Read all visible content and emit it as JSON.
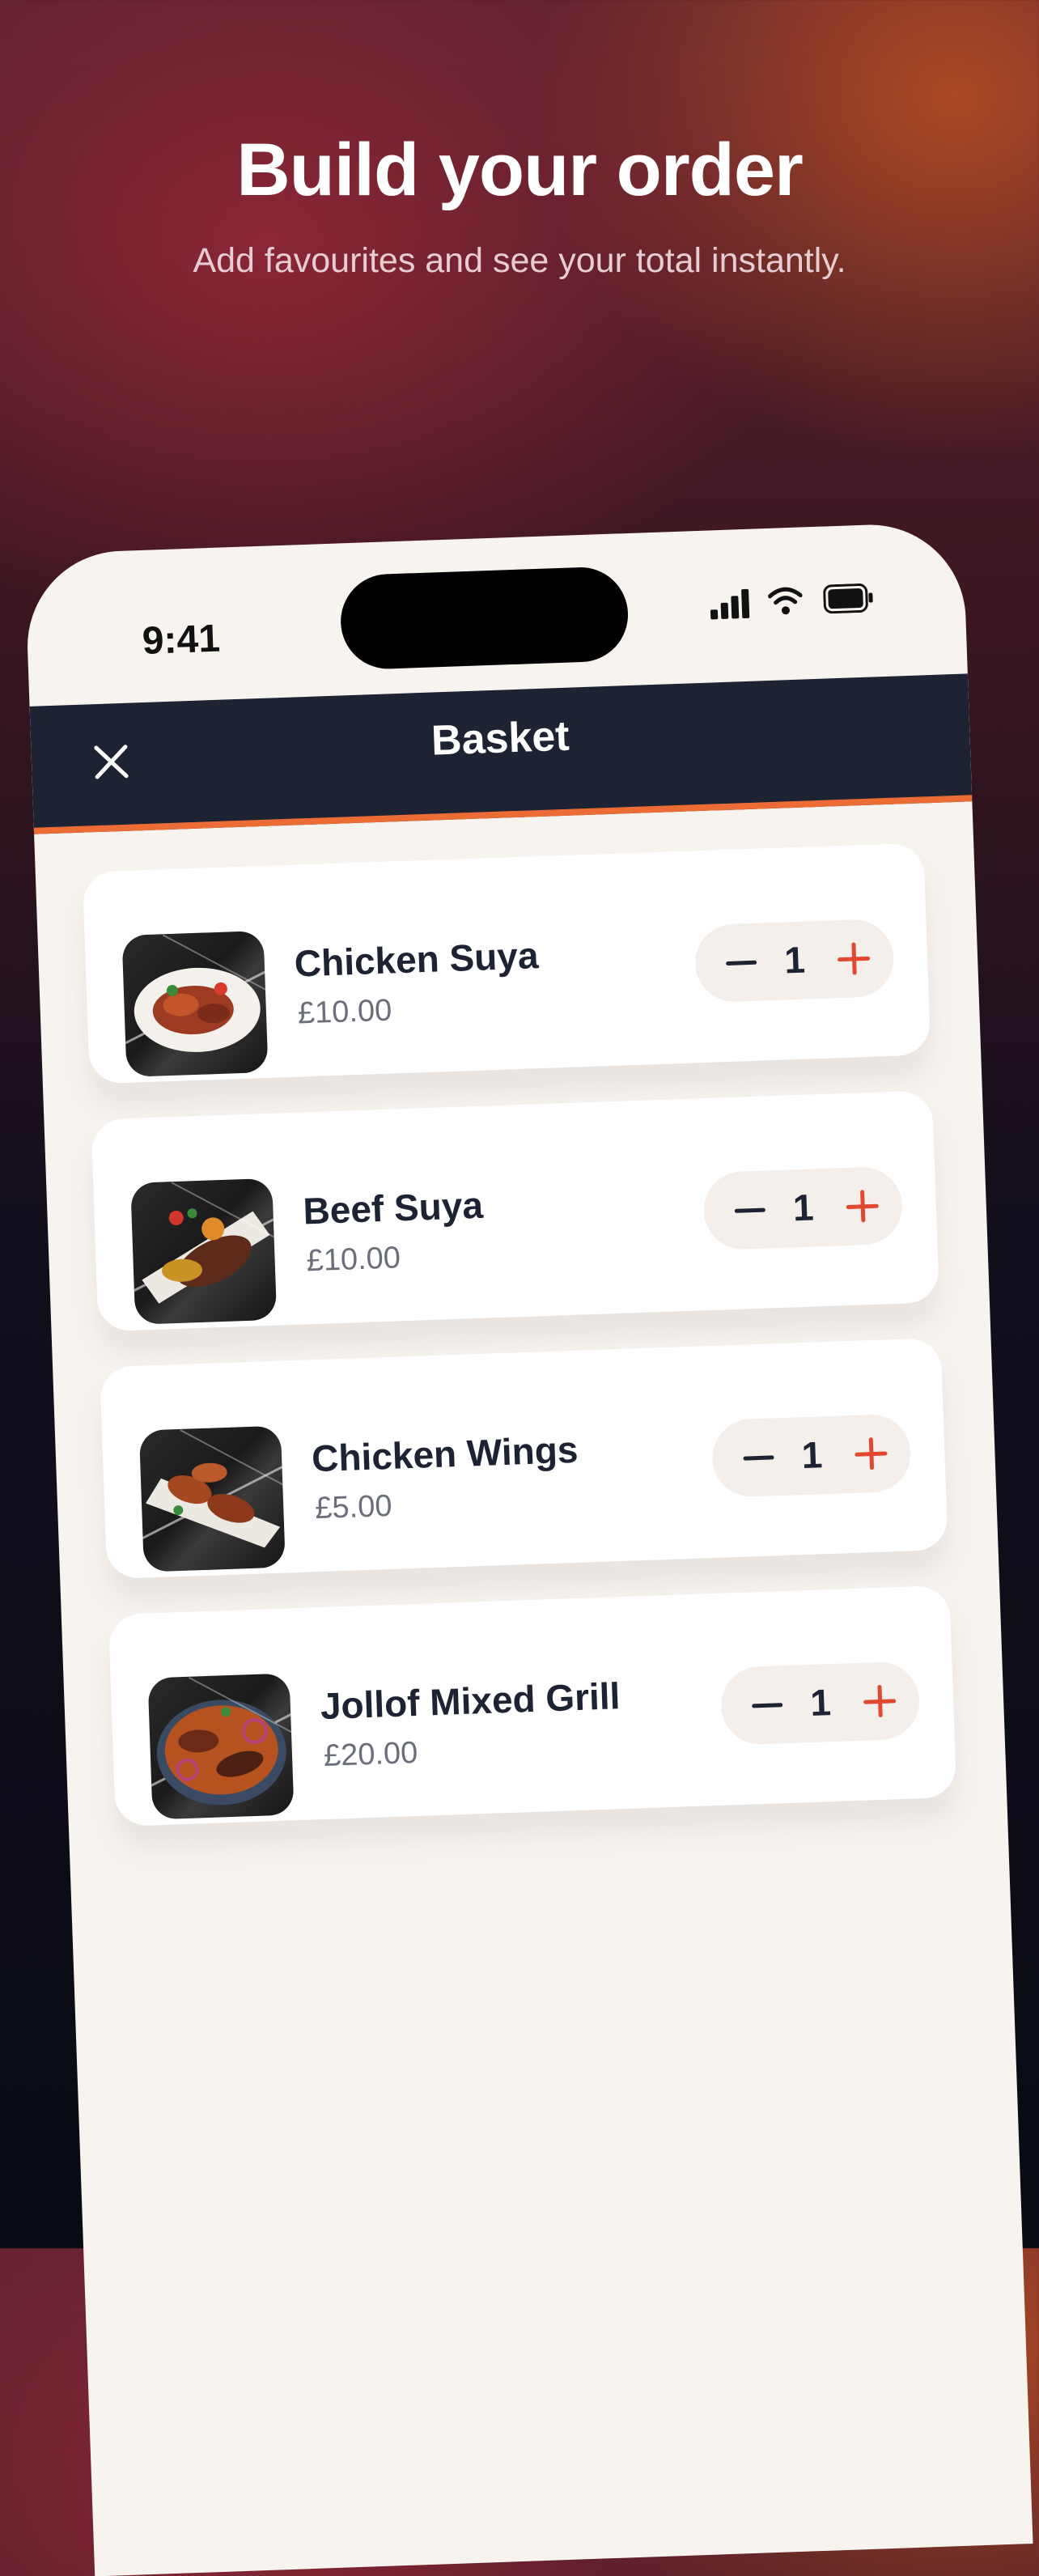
{
  "hero": {
    "title": "Build your order",
    "subtitle": "Add favourites and see your total instantly."
  },
  "status_bar": {
    "time": "9:41",
    "icons": [
      "signal-icon",
      "wifi-icon",
      "battery-icon"
    ]
  },
  "header": {
    "title": "Basket",
    "close_icon": "close-icon",
    "accent_color": "#ec6c35",
    "background_color": "#1e2334"
  },
  "basket": {
    "items": [
      {
        "name": "Chicken Suya",
        "price": "£10.00",
        "quantity": "1",
        "decrement": "–",
        "increment": "+"
      },
      {
        "name": "Beef Suya",
        "price": "£10.00",
        "quantity": "1",
        "decrement": "–",
        "increment": "+"
      },
      {
        "name": "Chicken Wings",
        "price": "£5.00",
        "quantity": "1",
        "decrement": "–",
        "increment": "+"
      },
      {
        "name": "Jollof Mixed Grill",
        "price": "£20.00",
        "quantity": "1",
        "decrement": "–",
        "increment": "+"
      }
    ]
  },
  "colors": {
    "increment": "#e2482f",
    "text_primary": "#1e2334",
    "card_background": "#ffffff",
    "screen_background": "#f7f3ef"
  }
}
